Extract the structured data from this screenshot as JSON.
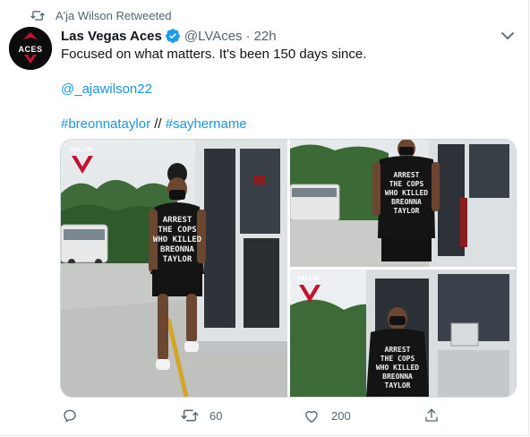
{
  "retweet_context": {
    "text": "A'ja Wilson Retweeted",
    "icon": "retweet-icon"
  },
  "author": {
    "name": "Las Vegas Aces",
    "verified": true,
    "handle": "@LVAces",
    "separator": "·",
    "time": "22h",
    "avatar_logo_text": "ACES"
  },
  "tweet": {
    "line1": "Focused on what matters. It's been 150 days since.",
    "mention": "@_ajawilson22",
    "hashtag1": "#breonnataylor",
    "separator": "//",
    "hashtag2": "#sayhername"
  },
  "media": {
    "watermark": "#ALLIN",
    "shirt_text": [
      "ARREST",
      "THE COPS",
      "WHO KILLED",
      "BREONNA",
      "TAYLOR"
    ]
  },
  "actions": {
    "reply_count": "",
    "retweet_count": "60",
    "like_count": "200"
  },
  "colors": {
    "accent": "#1b95e0",
    "verified": "#1d9bf0",
    "muted": "#536471",
    "aces_red": "#c4122f"
  }
}
